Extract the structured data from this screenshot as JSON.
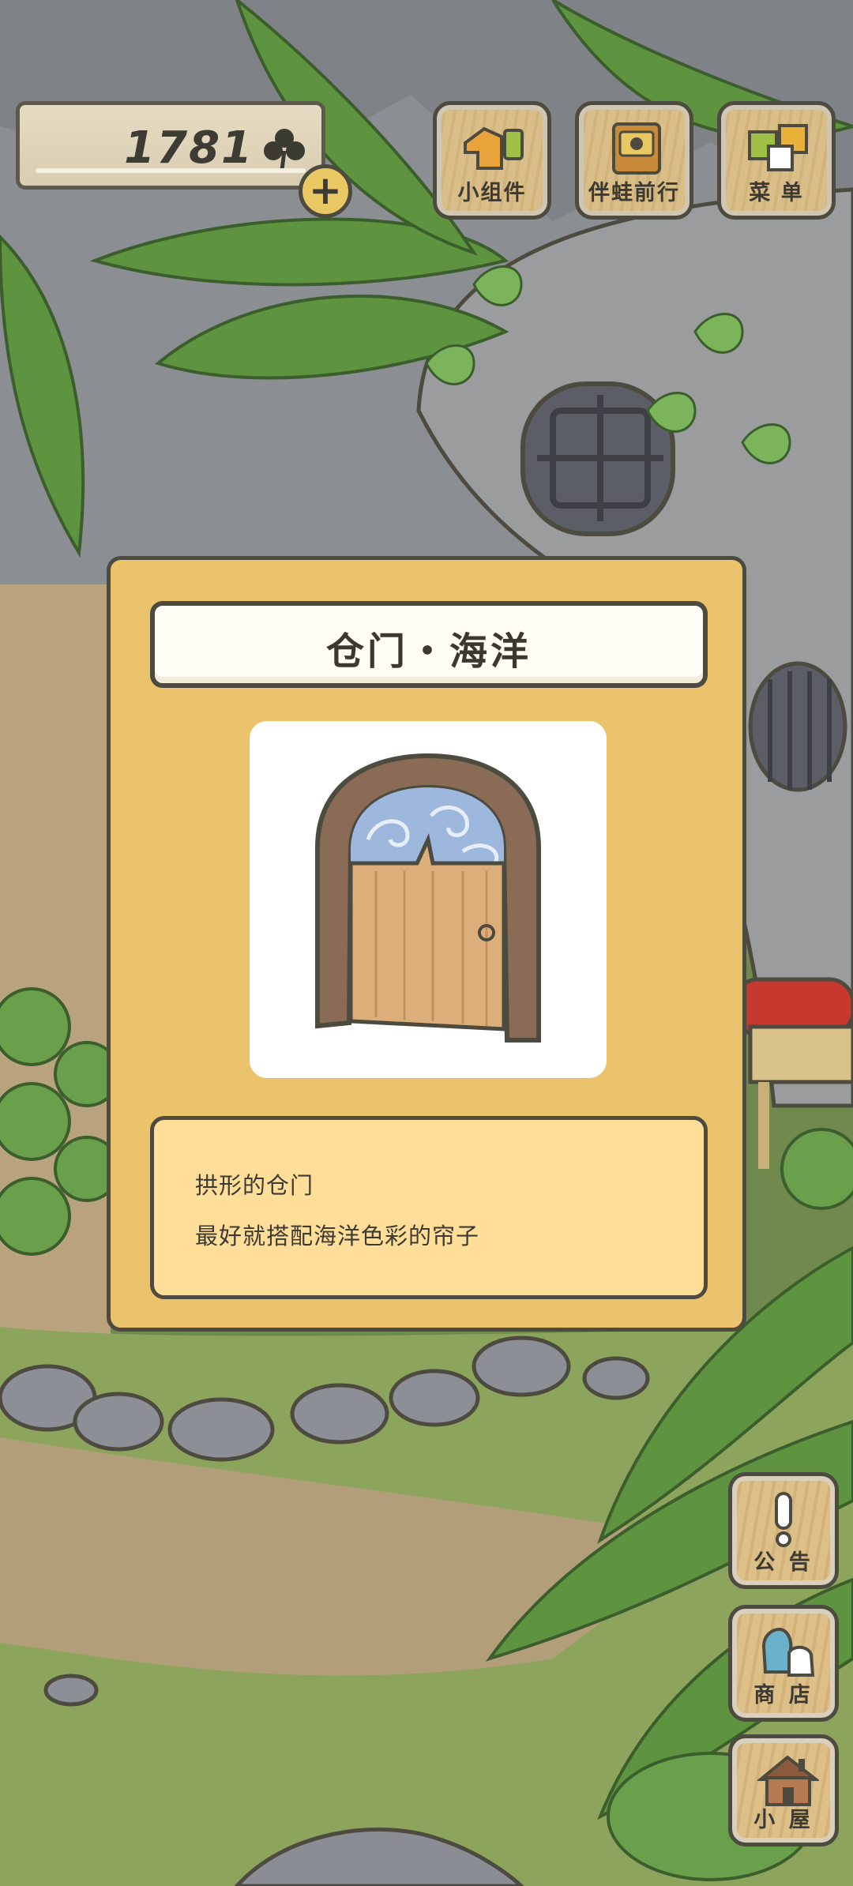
{
  "currency": {
    "count": "1781",
    "icon": "clover-icon",
    "add_icon": "plus-icon"
  },
  "top_buttons": [
    {
      "label": "小组件",
      "icon": "widget-icon"
    },
    {
      "label": "伴蛙前行",
      "icon": "frog-journey-icon"
    },
    {
      "label": "菜 单",
      "icon": "menu-cards-icon"
    }
  ],
  "item_card": {
    "title": "仓门・海洋",
    "image": "arched-door-ocean-icon",
    "description": [
      "拱形的仓门",
      "最好就搭配海洋色彩的帘子"
    ]
  },
  "side_buttons": [
    {
      "label": "公 告",
      "icon": "exclamation-icon"
    },
    {
      "label": "商 店",
      "icon": "shop-bags-icon"
    },
    {
      "label": "小 屋",
      "icon": "house-icon"
    }
  ],
  "colors": {
    "card": "#ebc36d",
    "card_description": "#ffde9a",
    "outline": "#4d4a40",
    "grass": "#7d9a52"
  }
}
